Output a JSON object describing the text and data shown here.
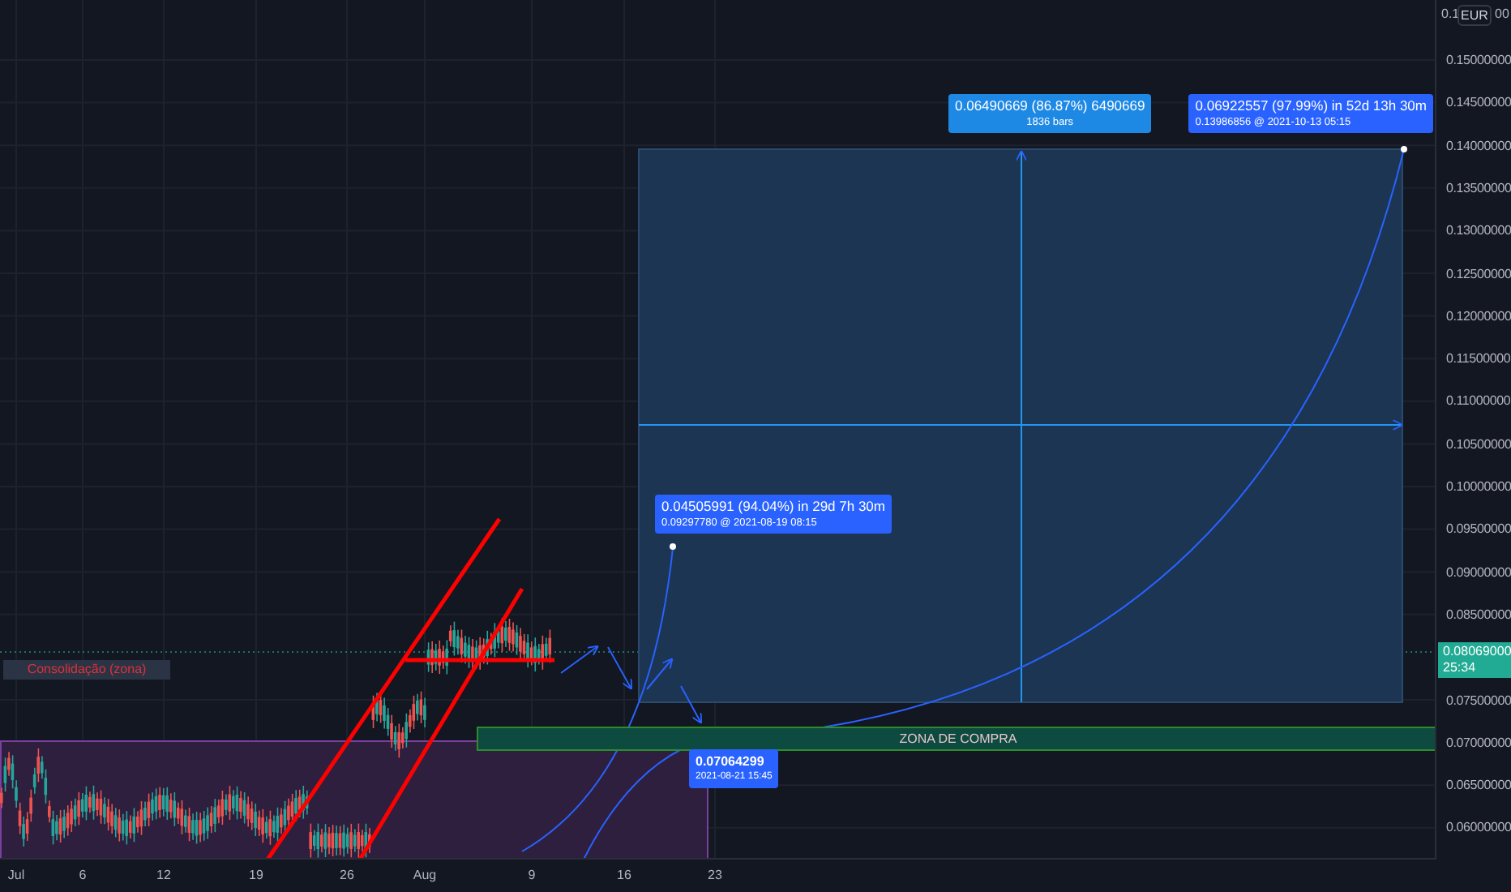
{
  "price_axis": {
    "currency": "EUR",
    "top_tick": [
      "0.1",
      "00"
    ],
    "ticks": [
      "0.15000000",
      "0.14500000",
      "0.14000000",
      "0.13500000",
      "0.13000000",
      "0.12500000",
      "0.12000000",
      "0.11500000",
      "0.11000000",
      "0.10500000",
      "0.10000000",
      "0.09500000",
      "0.09000000",
      "0.08500000",
      "0.07500000",
      "0.07000000",
      "0.06500000",
      "0.06000000"
    ],
    "current_price": "0.08069000",
    "countdown": "25:34"
  },
  "time_axis": {
    "ticks": [
      "Jul",
      "6",
      "12",
      "19",
      "26",
      "Aug",
      "9",
      "16",
      "23"
    ]
  },
  "zones": [
    {
      "kind": "consolidation",
      "label": "Consolidação (zona)"
    },
    {
      "kind": "buy",
      "label": "ZONA DE COMPRA"
    }
  ],
  "labels": [
    {
      "kind": "range",
      "lines": [
        "0.06490669 (86.87%) 6490669",
        "1836 bars"
      ]
    },
    {
      "kind": "measure",
      "lines": [
        "0.06922557 (97.99%) in 52d 13h 30m",
        "0.13986856 @ 2021-10-13  05:15"
      ]
    },
    {
      "kind": "measure",
      "lines": [
        "0.04505991 (94.04%) in 29d 7h 30m",
        "0.09297780 @ 2021-08-19  08:15"
      ]
    },
    {
      "kind": "point",
      "lines": [
        "0.07064299",
        "2021-08-21 15:45"
      ]
    }
  ]
}
